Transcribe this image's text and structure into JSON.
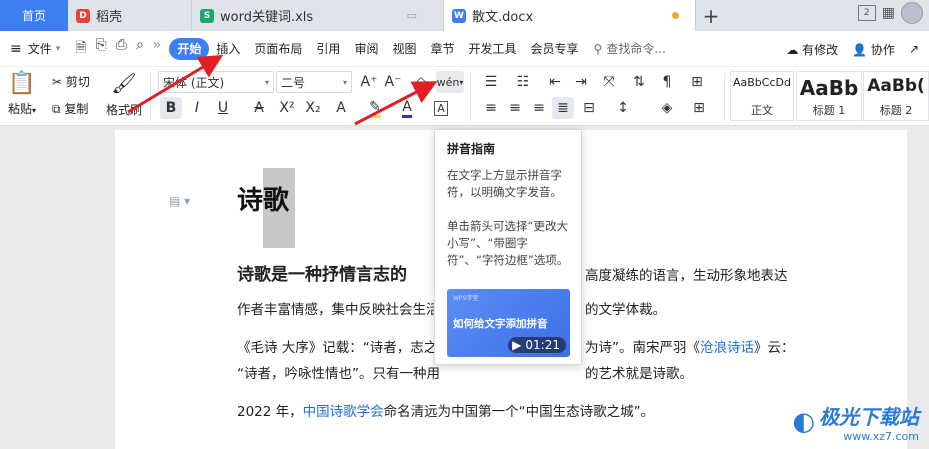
{
  "tabs": {
    "home": "首页",
    "items": [
      {
        "label": "稻壳",
        "color": "#e8423a",
        "icon_letter": "D"
      },
      {
        "label": "word关键词.xls",
        "color": "#17a86b",
        "icon_letter": "S"
      },
      {
        "label": "散文.docx",
        "color": "#3d7ff3",
        "icon_letter": "W",
        "active": true
      }
    ],
    "plus": "+"
  },
  "window": {
    "page_count": "2"
  },
  "menubar": {
    "file": "文件",
    "items": [
      "开始",
      "插入",
      "页面布局",
      "引用",
      "审阅",
      "视图",
      "章节",
      "开发工具",
      "会员专享"
    ],
    "active": "开始",
    "search": "查找命令...",
    "modified": "有修改",
    "collab": "协作"
  },
  "ribbon": {
    "paste": "粘贴",
    "cut": "剪切",
    "copy": "复制",
    "format_painter": "格式刷",
    "font_name": "宋体 (正文)",
    "font_size": "二号",
    "pinyin_icon": "wén",
    "styles": [
      {
        "preview": "AaBbCcDd",
        "label": "正文"
      },
      {
        "preview": "AaBb",
        "label": "标题 1"
      },
      {
        "preview": "AaBb(",
        "label": "标题 2"
      }
    ]
  },
  "document": {
    "title": "诗歌",
    "line1_bold": "诗歌是一种抒情言志的",
    "line1_rest": "高度凝练的语言，生动形象地表达",
    "line2_a": "作者丰富情感，集中反映社会生活",
    "line2_b": "的文学体裁。",
    "line3_a": "《毛诗 大序》记载：“诗者，志之",
    "line3_b": "为诗”。南宋严羽《",
    "line3_link": "沧浪诗话",
    "line3_c": "》云：",
    "line4_a": "“诗者，吟咏性情也”。只有一种用",
    "line4_b": "的艺术就是诗歌。",
    "line5_a": "2022 年，",
    "line5_link": "中国诗歌学会",
    "line5_b": "命名清远为中国第一个“中国生态诗歌之城”。"
  },
  "tooltip": {
    "title": "拼音指南",
    "body": "在文字上方显示拼音字符，以明确文字发音。\n\n单击箭头可选择“更改大小写”、“带圈字符”、“字符边框”选项。",
    "video_brand": "WPS学堂",
    "video_title": "如何给文字添加拼音",
    "video_duration": "01:21"
  },
  "watermark": {
    "name": "极光下载站",
    "url": "www.xz7.com"
  },
  "colors": {
    "accent": "#3d7ff3",
    "arrow": "#e02020",
    "link": "#1f6fd6"
  }
}
